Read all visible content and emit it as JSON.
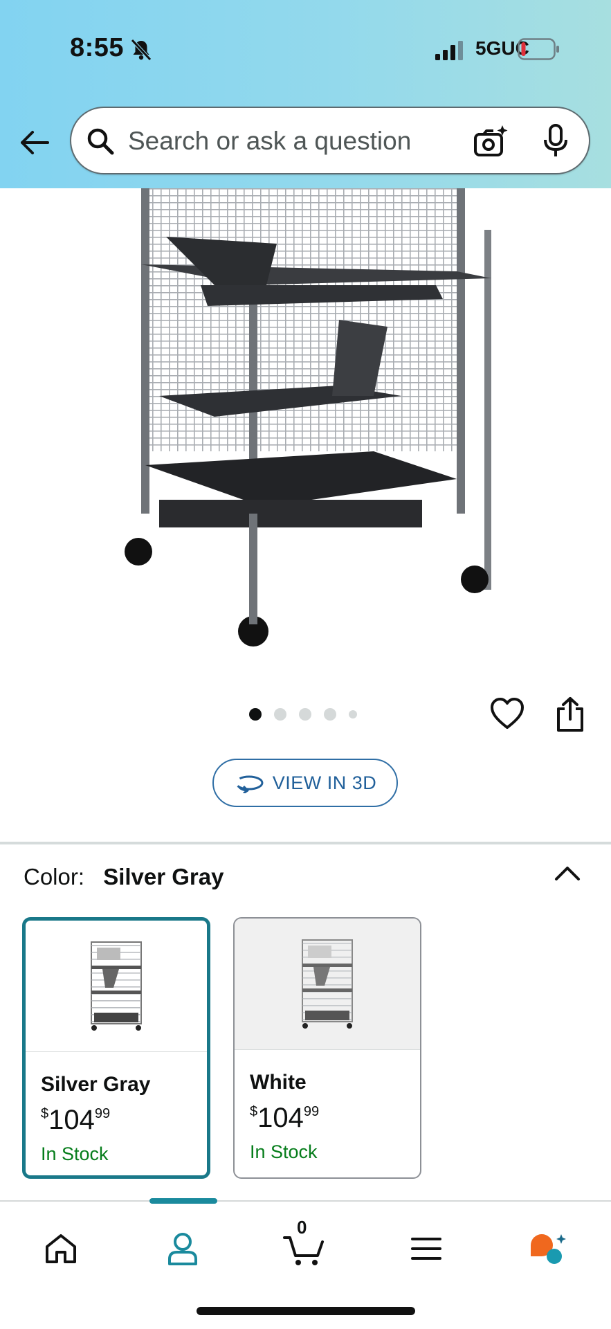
{
  "status_bar": {
    "time": "8:55",
    "network": "5GUC",
    "icons": [
      "bell-slash-icon",
      "signal-icon",
      "battery-icon"
    ],
    "battery_color": "#e0303a"
  },
  "search": {
    "placeholder": "Search or ask a question",
    "icons": [
      "back-arrow-icon",
      "search-icon",
      "camera-icon",
      "mic-icon"
    ]
  },
  "gallery": {
    "image_count": 5,
    "active_index": 0,
    "view_3d_label": "VIEW IN 3D",
    "icons": [
      "heart-icon",
      "share-icon"
    ]
  },
  "color_selector": {
    "label": "Color:",
    "selected": "Silver Gray",
    "options": [
      {
        "name": "Silver Gray",
        "price_whole": "104",
        "price_fraction": "99",
        "currency": "$",
        "stock": "In Stock",
        "selected": true
      },
      {
        "name": "White",
        "price_whole": "104",
        "price_fraction": "99",
        "currency": "$",
        "stock": "In Stock",
        "selected": false
      }
    ]
  },
  "bottom_nav": {
    "cart_count": "0",
    "items": [
      "home-icon",
      "account-icon",
      "cart-icon",
      "menu-icon",
      "rufus-icon"
    ],
    "active": "account-icon",
    "accent_color": "#1a8a9d"
  }
}
